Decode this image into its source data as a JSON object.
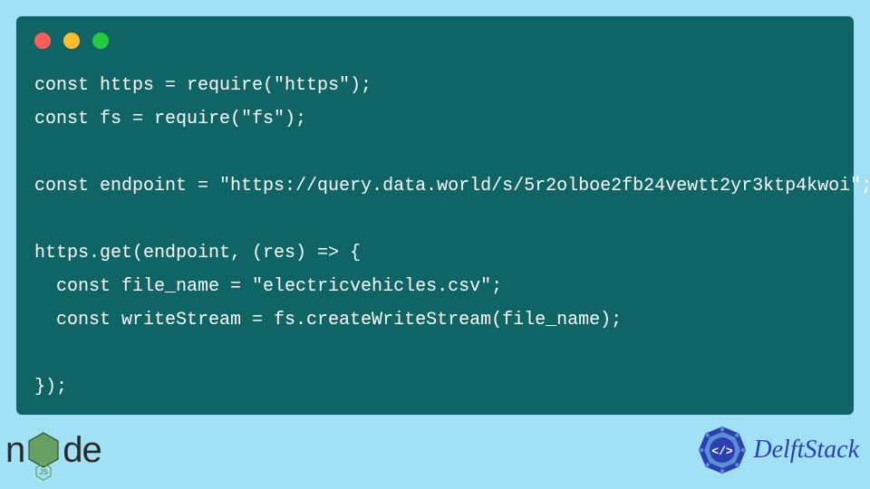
{
  "code": {
    "line1": "const https = require(\"https\");",
    "line2": "const fs = require(\"fs\");",
    "line3": "",
    "line4": "const endpoint = \"https://query.data.world/s/5r2olboe2fb24vewtt2yr3ktp4kwoi\";",
    "line5": "",
    "line6": "https.get(endpoint, (res) => {",
    "line7": "  const file_name = \"electricvehicles.csv\";",
    "line8": "  const writeStream = fs.createWriteStream(file_name);",
    "line9": "",
    "line10": "});"
  },
  "footer": {
    "node_left": "n",
    "node_right": "de",
    "delft": "DelftStack"
  }
}
